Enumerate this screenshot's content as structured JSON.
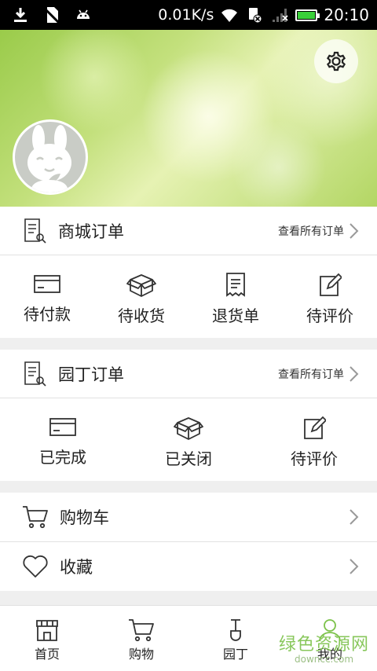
{
  "status_bar": {
    "left_icons": [
      "download-icon",
      "no-sim-icon",
      "android-icon"
    ],
    "speed": "0.01K/s",
    "right_icons": [
      "wifi-icon",
      "sim-icon",
      "signal-icon",
      "battery-icon"
    ],
    "time": "20:10"
  },
  "header": {
    "settings_icon": "gear-icon",
    "avatar_icon": "rabbit-avatar-icon"
  },
  "mall_orders": {
    "title": "商城订单",
    "view_all": "查看所有订单",
    "items": [
      {
        "label": "待付款",
        "icon": "card-icon"
      },
      {
        "label": "待收货",
        "icon": "box-icon"
      },
      {
        "label": "退货单",
        "icon": "receipt-icon"
      },
      {
        "label": "待评价",
        "icon": "edit-icon"
      }
    ]
  },
  "gardener_orders": {
    "title": "园丁订单",
    "view_all": "查看所有订单",
    "items": [
      {
        "label": "已完成",
        "icon": "card-icon"
      },
      {
        "label": "已关闭",
        "icon": "box-icon"
      },
      {
        "label": "待评价",
        "icon": "edit-icon"
      }
    ]
  },
  "list": {
    "cart": "购物车",
    "favorites": "收藏"
  },
  "bottom_nav": {
    "items": [
      {
        "label": "首页",
        "icon": "store-icon"
      },
      {
        "label": "购物",
        "icon": "cart-icon"
      },
      {
        "label": "园丁",
        "icon": "shovel-icon"
      },
      {
        "label": "我的",
        "icon": "person-icon"
      }
    ]
  },
  "watermark": {
    "text": "绿色资源网",
    "url": "downcc.com"
  },
  "colors": {
    "accent_green": "#7cc24a",
    "battery_green": "#3ad03a"
  }
}
